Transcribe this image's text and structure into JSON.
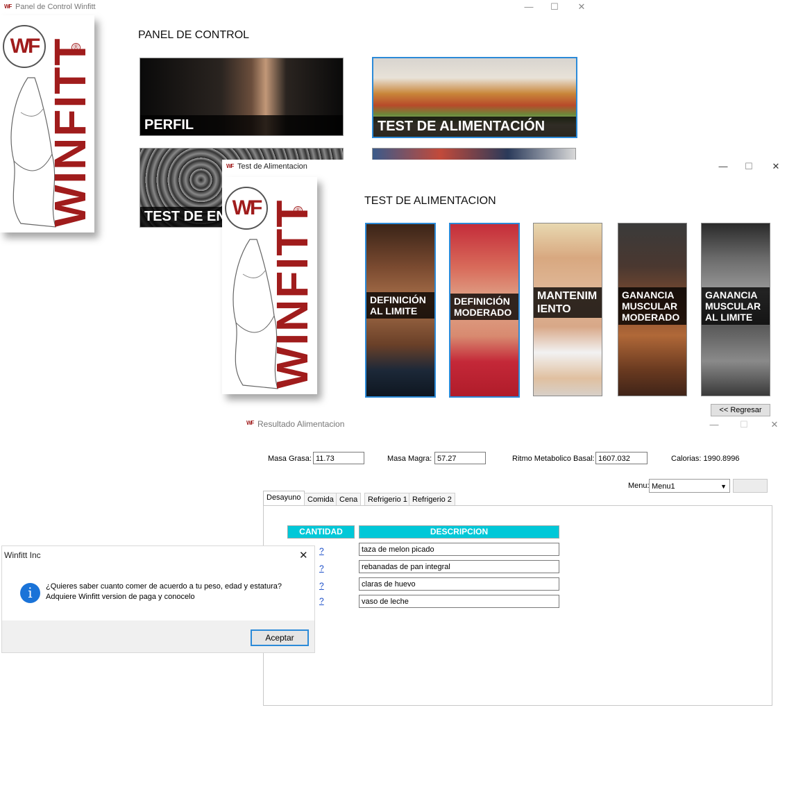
{
  "panel_window": {
    "title": "Panel de Control Winfitt",
    "heading": "PANEL DE CONTROL",
    "tiles": [
      "PERFIL",
      "TEST DE ALIMENTACIÓN",
      "TEST DE EN"
    ]
  },
  "logo": {
    "initials": "WF",
    "word": "WINFITT",
    "reg": "®"
  },
  "test_window": {
    "title": "Test de Alimentacion",
    "heading": "TEST DE ALIMENTACION",
    "cards": [
      [
        "DEFINICIÓN",
        "AL LIMITE"
      ],
      [
        "DEFINICIÓN",
        "MODERADO"
      ],
      [
        "MANTENIM",
        "IENTO"
      ],
      [
        "GANANCIA",
        "MUSCULAR",
        "MODERADO"
      ],
      [
        "GANANCIA",
        "MUSCULAR",
        "AL LIMITE"
      ]
    ],
    "back_button": "<< Regresar"
  },
  "result_window": {
    "title": "Resultado Alimentacion",
    "masa_grasa_label": "Masa Grasa:",
    "masa_grasa_value": "11.73",
    "masa_magra_label": "Masa Magra:",
    "masa_magra_value": "57.27",
    "rmb_label": "Ritmo Metabolico Basal:",
    "rmb_value": "1607.032",
    "calorias": "Calorias: 1990.8996",
    "menu_label": "Menu:",
    "menu_value": "Menu1",
    "tabs": [
      "Desayuno",
      "Comida",
      "Cena",
      "Refrigerio 1",
      "Refrigerio 2"
    ],
    "col_cantidad": "CANTIDAD",
    "col_descripcion": "DESCRIPCION",
    "rows": [
      {
        "qty": "?",
        "desc": "taza de melon picado"
      },
      {
        "qty": "?",
        "desc": "rebanadas de pan integral"
      },
      {
        "qty": "?",
        "desc": "claras de huevo"
      },
      {
        "qty": "?",
        "desc": "vaso de leche"
      }
    ]
  },
  "dialog": {
    "title": "Winfitt Inc",
    "line1": "¿Quieres saber cuanto comer de acuerdo a tu peso, edad y estatura?",
    "line2": "Adquiere Winfitt version de paga y conocelo",
    "ok_button": "Aceptar",
    "info_icon": "i"
  },
  "colors": {
    "brand": "#a01c1c",
    "cyan": "#00c8d8",
    "accent": "#2b8ad8"
  }
}
